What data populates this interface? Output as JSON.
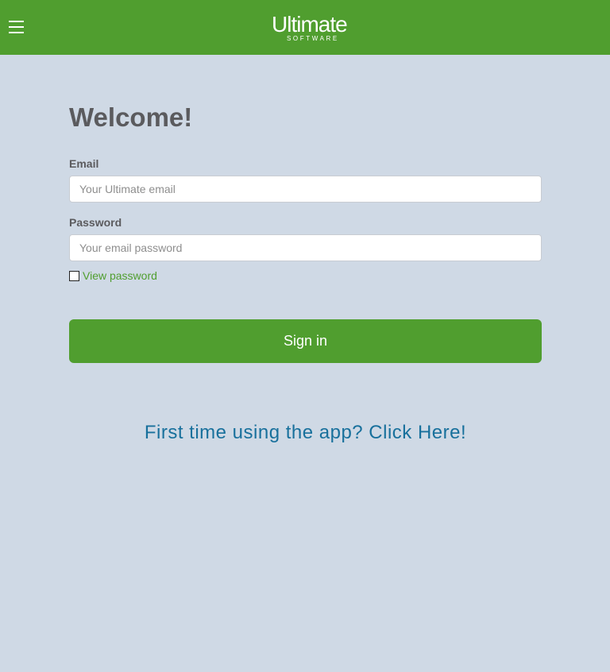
{
  "header": {
    "menu_icon": "hamburger-menu-icon",
    "logo": {
      "word": "Ultimate",
      "sub": "SOFTWARE"
    },
    "color": "#509e2f"
  },
  "login": {
    "title": "Welcome!",
    "email": {
      "label": "Email",
      "placeholder": "Your Ultimate email",
      "value": ""
    },
    "password": {
      "label": "Password",
      "placeholder": "Your email password",
      "value": ""
    },
    "view_password": {
      "label": "View password",
      "checked": false
    },
    "sign_in_label": "Sign in",
    "first_time_link": "First time using the app? Click Here!"
  },
  "colors": {
    "brand_green": "#509e2f",
    "background": "#cfd9e5",
    "link_blue": "#18709c",
    "heading_gray": "#5b5b5e"
  }
}
